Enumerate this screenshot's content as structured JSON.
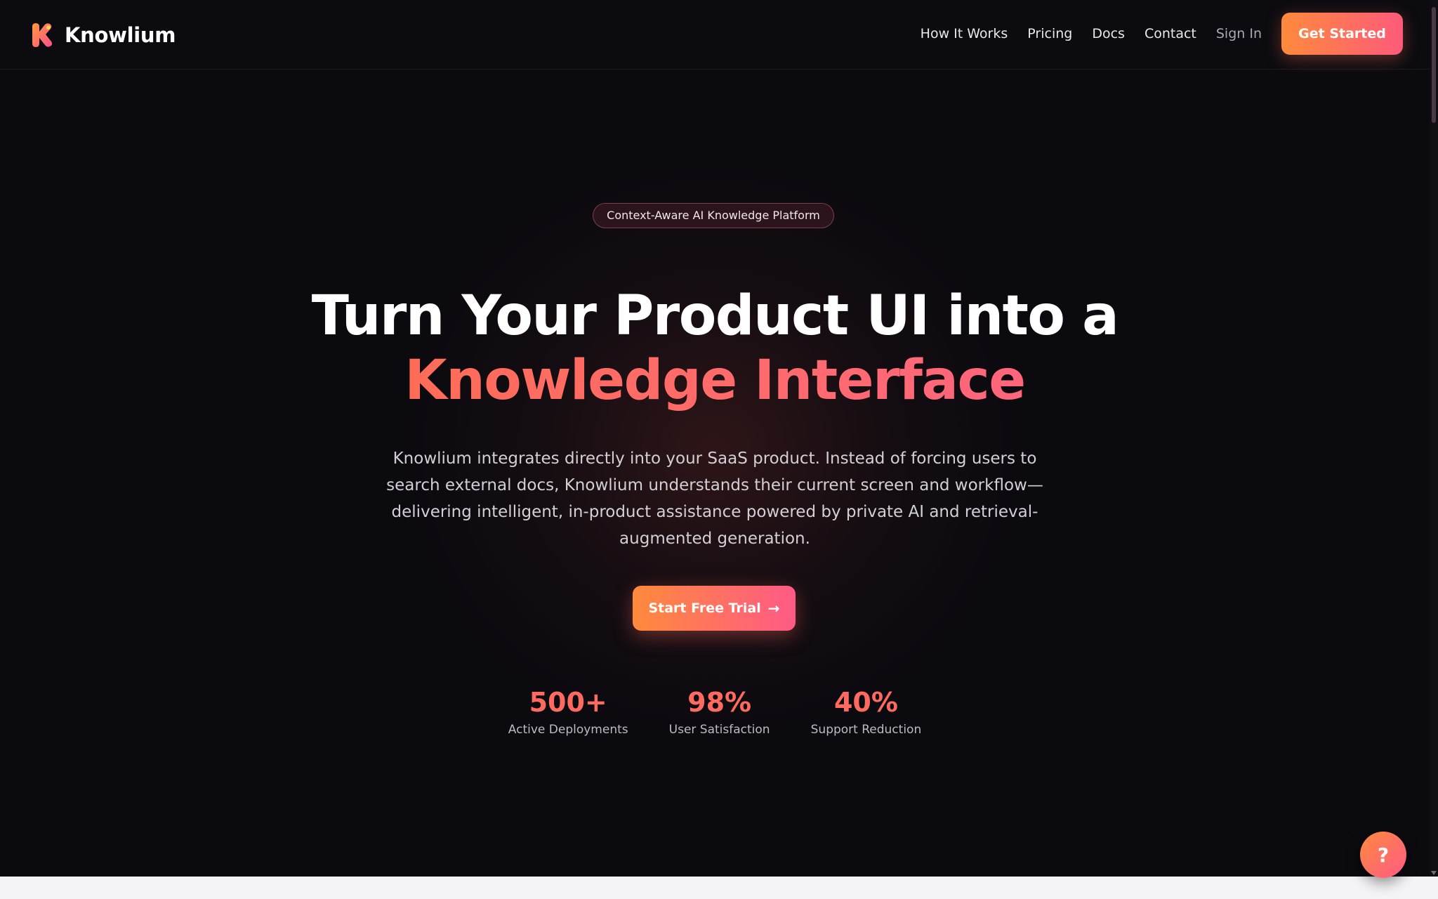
{
  "page_progress": {
    "fraction": 0.2
  },
  "header": {
    "brand_name": "Knowlium",
    "logo_icon": "knowlium-logo-icon",
    "nav": [
      {
        "label": "How It Works"
      },
      {
        "label": "Pricing"
      },
      {
        "label": "Docs"
      },
      {
        "label": "Contact"
      },
      {
        "label": "Sign In"
      }
    ],
    "cta_label": "Get Started"
  },
  "hero": {
    "badge": "Context-Aware AI Knowledge Platform",
    "title_line1": "Turn Your Product UI into a",
    "title_line2": "Knowledge Interface",
    "description": "Knowlium integrates directly into your SaaS product. Instead of forcing users to search external docs, Knowlium understands their current screen and workflow—delivering intelligent, in-product assistance powered by private AI and retrieval-augmented generation.",
    "cta_label": "Start Free Trial",
    "cta_icon": "arrow-right-icon",
    "cta_arrow": "→"
  },
  "stats": [
    {
      "value": "500+",
      "label": "Active Deployments"
    },
    {
      "value": "98%",
      "label": "User Satisfaction"
    },
    {
      "value": "40%",
      "label": "Support Reduction"
    }
  ],
  "help": {
    "label": "?",
    "icon": "help-icon"
  },
  "colors": {
    "background": "#0b0a0f",
    "accent_orange": "#ff8a3c",
    "accent_pink": "#ff5a86",
    "stat_value": "#ff6a60",
    "progress_fill": "#27a3b8"
  }
}
